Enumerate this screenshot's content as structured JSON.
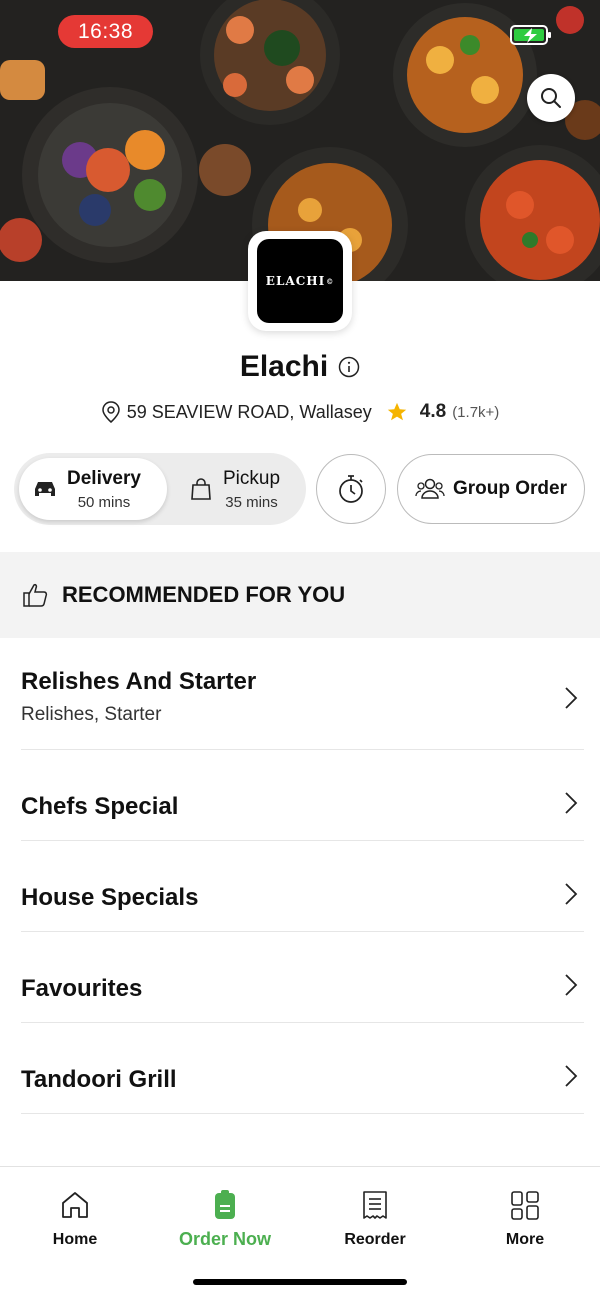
{
  "status_bar": {
    "time": "16:38"
  },
  "restaurant": {
    "logo_text": "ELACHI",
    "name": "Elachi",
    "address": "59 SEAVIEW ROAD, Wallasey",
    "rating": "4.8",
    "rating_count": "(1.7k+)"
  },
  "order_mode": {
    "delivery": {
      "label": "Delivery",
      "time": "50 mins"
    },
    "pickup": {
      "label": "Pickup",
      "time": "35 mins"
    },
    "group_order_label": "Group Order"
  },
  "recommended_label": "RECOMMENDED FOR YOU",
  "menu": [
    {
      "title": "Relishes And Starter",
      "subtitle": "Relishes, Starter"
    },
    {
      "title": "Chefs Special"
    },
    {
      "title": "House Specials"
    },
    {
      "title": "Favourites"
    },
    {
      "title": "Tandoori Grill"
    }
  ],
  "bottom_nav": [
    {
      "label": "Home",
      "icon": "home-icon"
    },
    {
      "label": "Order Now",
      "icon": "order-icon",
      "active": true
    },
    {
      "label": "Reorder",
      "icon": "receipt-icon"
    },
    {
      "label": "More",
      "icon": "grid-icon"
    }
  ],
  "colors": {
    "accent": "#4caf50",
    "status_pill": "#e53935",
    "star": "#f5b400",
    "battery": "#2ecc40"
  }
}
